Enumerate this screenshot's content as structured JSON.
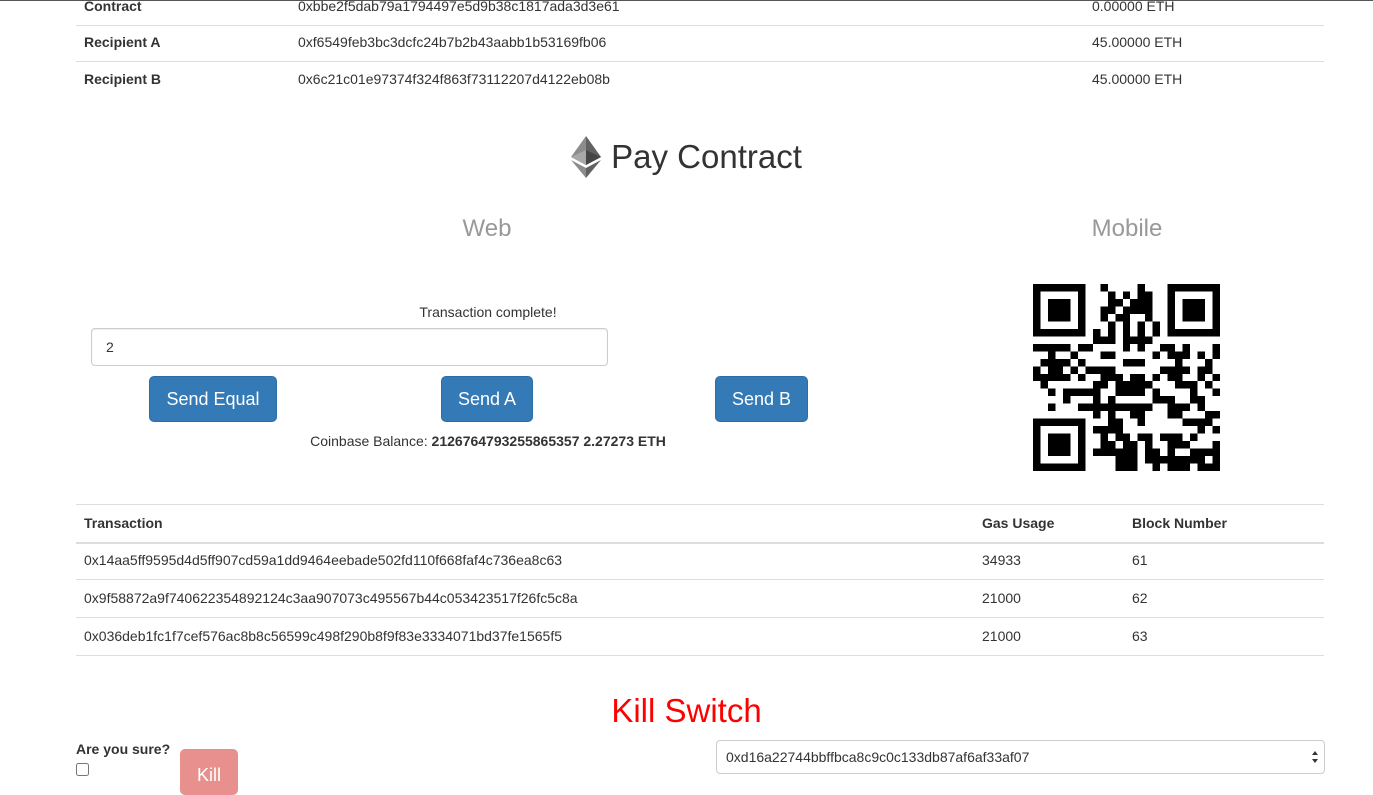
{
  "accounts": [
    {
      "label": "Contract",
      "address": "0xbbe2f5dab79a1794497e5d9b38c1817ada3d3e61",
      "balance": "0.00000 ETH"
    },
    {
      "label": "Recipient A",
      "address": "0xf6549feb3bc3dcfc24b7b2b43aabb1b53169fb06",
      "balance": "45.00000 ETH"
    },
    {
      "label": "Recipient B",
      "address": "0x6c21c01e97374f324f863f73112207d4122eb08b",
      "balance": "45.00000 ETH"
    }
  ],
  "pay": {
    "title": "Pay Contract",
    "logo_icon": "ethereum-icon",
    "web_heading": "Web",
    "mobile_heading": "Mobile",
    "status": "Transaction complete!",
    "amount_value": "2",
    "buttons": {
      "send_equal": "Send Equal",
      "send_a": "Send A",
      "send_b": "Send B"
    },
    "coinbase_label": "Coinbase Balance:",
    "coinbase_value": "2126764793255865357 2.27273 ETH"
  },
  "transactions": {
    "headers": {
      "transaction": "Transaction",
      "gas": "Gas Usage",
      "block": "Block Number"
    },
    "rows": [
      {
        "hash": "0x14aa5ff9595d4d5ff907cd59a1dd9464eebade502fd110f668faf4c736ea8c63",
        "gas": "34933",
        "block": "61"
      },
      {
        "hash": "0x9f58872a9f740622354892124c3aa907073c495567b44c053423517f26fc5c8a",
        "gas": "21000",
        "block": "62"
      },
      {
        "hash": "0x036deb1fc1f7cef576ac8b8c56599c498f290b8f9f83e3334071bd37fe1565f5",
        "gas": "21000",
        "block": "63"
      }
    ]
  },
  "kill": {
    "title": "Kill Switch",
    "confirm_label": "Are you sure?",
    "button_label": "Kill",
    "selected_address": "0xd16a22744bbffbca8c9c0c133db87af6af33af07"
  },
  "colors": {
    "primary": "#337ab7",
    "danger": "#ff0000",
    "kill_button": "#e8908e"
  }
}
